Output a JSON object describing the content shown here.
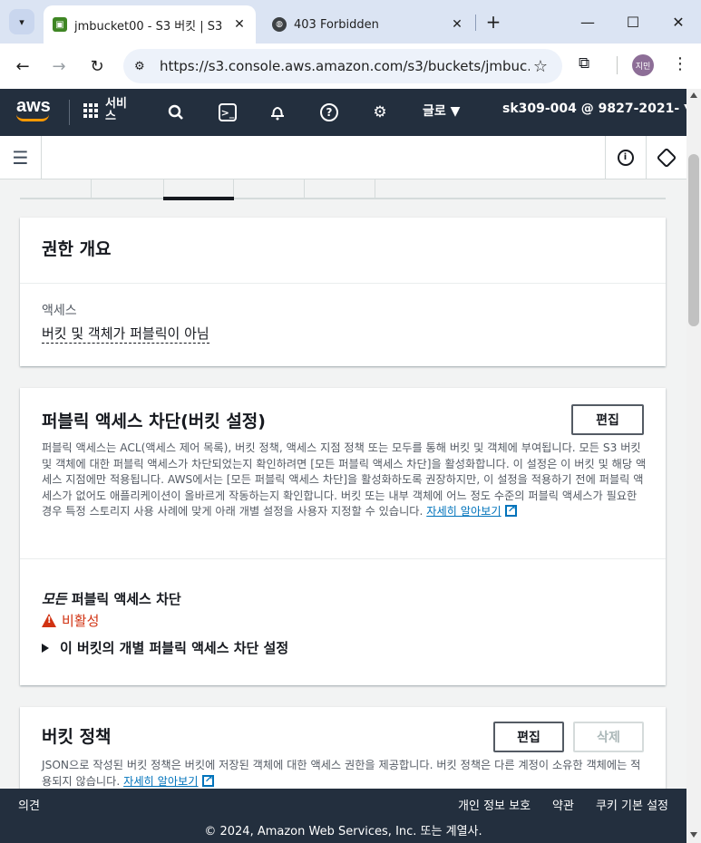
{
  "browser": {
    "tabs": [
      {
        "title": "jmbucket00 - S3 버킷 | S3",
        "active": true,
        "favicon": "s3-favicon"
      },
      {
        "title": "403 Forbidden",
        "active": false,
        "favicon": "globe-favicon"
      }
    ],
    "url": "https://s3.console.aws.amazon.com/s3/buckets/jmbuc...",
    "profile_initials": "지민"
  },
  "aws_nav": {
    "logo": "aws",
    "services_label": "서비스",
    "region": "글로 ▼",
    "account": "sk309-004 @ 9827-2021- ▼"
  },
  "permissions_overview": {
    "title": "권한 개요",
    "access_label": "액세스",
    "access_value": "버킷 및 객체가 퍼블릭이 아님"
  },
  "block_public_access": {
    "title": "퍼블릭 액세스 차단(버킷 설정)",
    "edit_label": "편집",
    "description": "퍼블릭 액세스는 ACL(액세스 제어 목록), 버킷 정책, 액세스 지점 정책 또는 모두를 통해 버킷 및 객체에 부여됩니다. 모든 S3 버킷 및 객체에 대한 퍼블릭 액세스가 차단되었는지 확인하려면 [모든 퍼블릭 액세스 차단]을 활성화합니다. 이 설정은 이 버킷 및 해당 액세스 지점에만 적용됩니다. AWS에서는 [모든 퍼블릭 액세스 차단]을 활성화하도록 권장하지만, 이 설정을 적용하기 전에 퍼블릭 액세스가 없어도 애플리케이션이 올바르게 작동하는지 확인합니다. 버킷 또는 내부 객체에 어느 정도 수준의 퍼블릭 액세스가 필요한 경우 특정 스토리지 사용 사례에 맞게 아래 개별 설정을 사용자 지정할 수 있습니다.",
    "learn_more": "자세히 알아보기",
    "block_all_em": "모든",
    "block_all_rest": " 퍼블릭 액세스 차단",
    "status": "비활성",
    "expander_label": "이 버킷의 개별 퍼블릭 액세스 차단 설정"
  },
  "bucket_policy": {
    "title": "버킷 정책",
    "edit_label": "편집",
    "delete_label": "삭제",
    "description": "JSON으로 작성된 버킷 정책은 버킷에 저장된 객체에 대한 액세스 권한을 제공합니다. 버킷 정책은 다른 계정이 소유한 객체에는 적용되지 않습니다.",
    "learn_more": "자세히 알아보기"
  },
  "footer": {
    "feedback": "의견",
    "privacy": "개인 정보 보호",
    "terms": "약관",
    "cookies": "쿠키 기본 설정",
    "copyright": "© 2024, Amazon Web Services, Inc. 또는 계열사."
  },
  "colors": {
    "aws_nav": "#232f3e",
    "aws_orange": "#ff9900",
    "link": "#0073bb",
    "error": "#d13212"
  }
}
